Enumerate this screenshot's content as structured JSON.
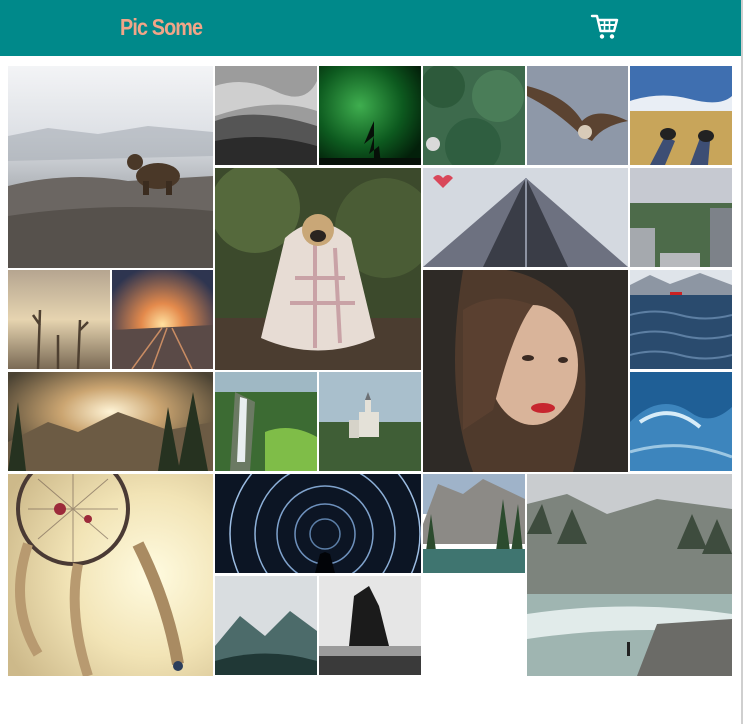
{
  "header": {
    "brand": "Pic Some",
    "cart_icon": "shopping-cart-icon",
    "background_color": "#00898a",
    "brand_color": "#f1a588"
  },
  "gallery": {
    "photos": [
      {
        "name": "photo-bear"
      },
      {
        "name": "photo-misty-forest-bw"
      },
      {
        "name": "photo-green-aurora"
      },
      {
        "name": "photo-pine-tree-aerial"
      },
      {
        "name": "photo-eagle"
      },
      {
        "name": "photo-feet-in-field"
      },
      {
        "name": "photo-pug-in-blanket"
      },
      {
        "name": "photo-skyscraper"
      },
      {
        "name": "photo-city-park"
      },
      {
        "name": "photo-foggy-dead-trees"
      },
      {
        "name": "photo-sunset-railway"
      },
      {
        "name": "photo-woman-portrait"
      },
      {
        "name": "photo-lake-waves"
      },
      {
        "name": "photo-mountain-sunrise"
      },
      {
        "name": "photo-waterfall"
      },
      {
        "name": "photo-castle"
      },
      {
        "name": "photo-ocean-wave"
      },
      {
        "name": "photo-dreamcatcher"
      },
      {
        "name": "photo-star-trails"
      },
      {
        "name": "photo-canyon-lake"
      },
      {
        "name": "photo-misty-river"
      },
      {
        "name": "photo-misty-mountain"
      },
      {
        "name": "photo-sea-stack"
      }
    ]
  }
}
